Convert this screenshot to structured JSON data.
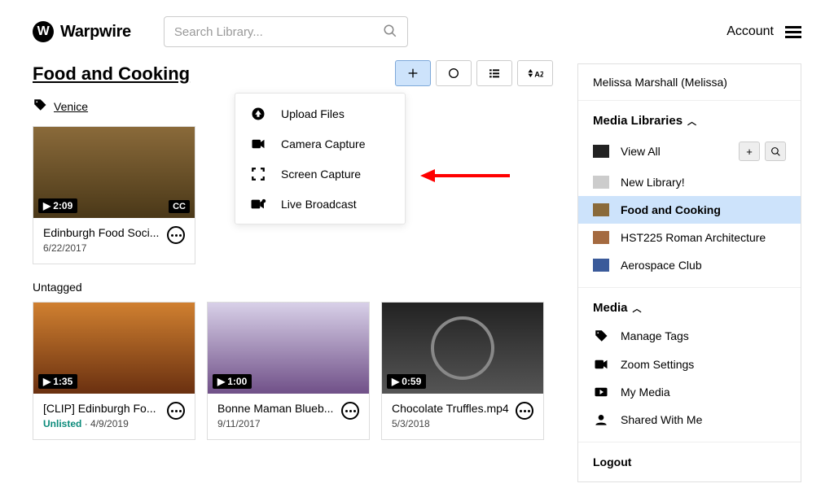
{
  "header": {
    "brand": "Warpwire",
    "search_placeholder": "Search Library...",
    "account": "Account"
  },
  "library": {
    "title": "Food and Cooking",
    "tag": {
      "label": "Venice"
    },
    "sections": {
      "venice": "Venice",
      "untagged": "Untagged",
      "untagged_label": "Untagged"
    },
    "cards": [
      {
        "duration": "2:09",
        "cc": "CC",
        "title": "Edinburgh Food Soci...",
        "sub": "6/22/2017"
      }
    ],
    "untagged_cards": [
      {
        "duration": "1:35",
        "title": "[CLIP] Edinburgh Fo...",
        "unlisted": "Unlisted",
        "dot": "·",
        "date": "4/9/2019"
      },
      {
        "duration": "1:00",
        "title": "Bonne Maman Blueb...",
        "sub": "9/11/2017"
      },
      {
        "duration": "0:59",
        "title": "Chocolate Truffles.mp4",
        "sub": "5/3/2018"
      }
    ]
  },
  "dropdown": {
    "items": [
      {
        "label": "Upload Files"
      },
      {
        "label": "Camera Capture"
      },
      {
        "label": "Screen Capture"
      },
      {
        "label": "Live Broadcast"
      }
    ]
  },
  "sidebar": {
    "user": "Melissa Marshall (Melissa)",
    "libs_heading": "Media Libraries",
    "libs": [
      {
        "label": "View All",
        "actions": true
      },
      {
        "label": "New Library!"
      },
      {
        "label": "Food and Cooking",
        "active": true
      },
      {
        "label": "HST225 Roman Architecture"
      },
      {
        "label": "Aerospace Club"
      }
    ],
    "media_heading": "Media",
    "media_items": [
      {
        "label": "Manage Tags",
        "icon": "tag"
      },
      {
        "label": "Zoom Settings",
        "icon": "cam"
      },
      {
        "label": "My Media",
        "icon": "play"
      },
      {
        "label": "Shared With Me",
        "icon": "person"
      }
    ],
    "logout": "Logout"
  },
  "icons": {
    "play": "▶",
    "plus": "+",
    "search": "🔍"
  }
}
